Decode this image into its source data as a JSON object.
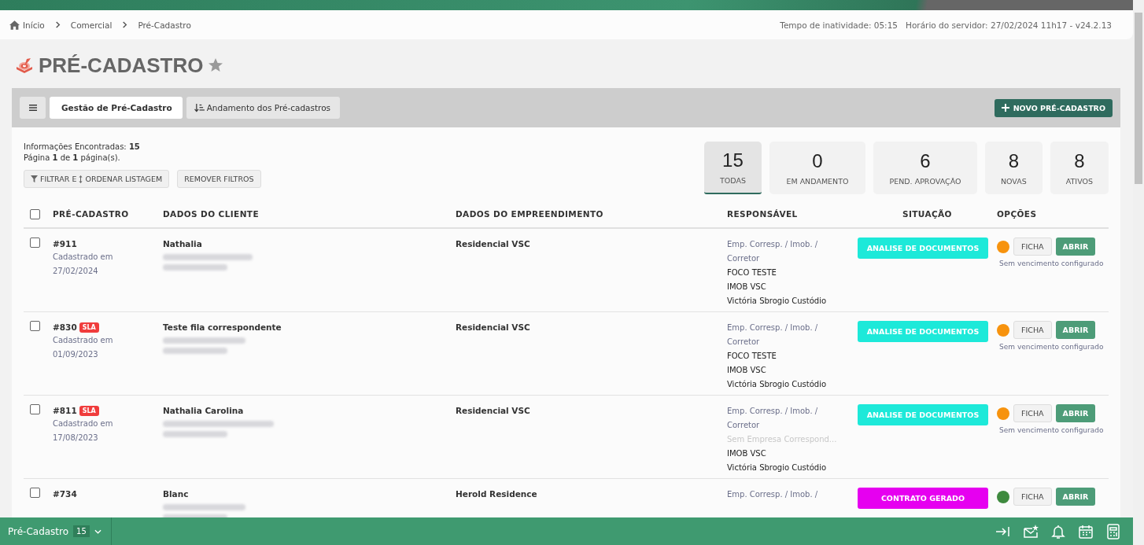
{
  "breadcrumb": [
    {
      "label": "Início",
      "kind": "home"
    },
    {
      "label": "Comercial"
    },
    {
      "label": "Pré-Cadastro"
    }
  ],
  "status_info": {
    "idle": "Tempo de inatividade: 05:15",
    "server": "Horário do servidor: 27/02/2024 11h17 - v24.2.13"
  },
  "page_title": "PRÉ-CADASTRO",
  "favorite": false,
  "tabs": [
    {
      "label": "Gestão de Pré-Cadastro",
      "selected": true,
      "kind": "plain"
    },
    {
      "label": "Andamento dos Pré-cadastros",
      "selected": false,
      "kind": "sort"
    }
  ],
  "new_button": "NOVO PRÉ-CADASTRO",
  "summary": {
    "found_label": "Informações Encontradas: ",
    "found": "15",
    "page_text": "Página **1** de **1** página(s)."
  },
  "filter_buttons": [
    {
      "label": "FILTRAR E",
      "label2": "ORDENAR LISTAGEM",
      "kind": "filter"
    },
    {
      "label": "REMOVER FILTROS",
      "kind": "plain"
    }
  ],
  "counters": [
    {
      "value": "15",
      "label": "TODAS",
      "selected": true
    },
    {
      "value": "0",
      "label": "EM ANDAMENTO",
      "selected": false
    },
    {
      "value": "6",
      "label": "PEND. APROVAÇÃO",
      "selected": false
    },
    {
      "value": "8",
      "label": "NOVAS",
      "selected": false
    },
    {
      "value": "8",
      "label": "ATIVOS",
      "selected": false
    }
  ],
  "table": {
    "all_checked": false,
    "columns": [
      "PRÉ-CADASTRO",
      "DADOS DO CLIENTE",
      "DADOS DO EMPREENDIMENTO",
      "RESPONSÁVEL",
      "SITUAÇÃO",
      "OPÇÕES"
    ],
    "rows": [
      {
        "checked": false,
        "id": "#911",
        "sla": null,
        "registered": "Cadastrado em",
        "date": "27/02/2024",
        "client": "Nathalia",
        "project": "Residencial VSC",
        "resp_label": "Emp. Corresp. / Imob. / Corretor",
        "resp": [
          {
            "text": "FOCO TESTE",
            "muted": false
          },
          {
            "text": "IMOB VSC",
            "muted": false
          },
          {
            "text": "Victória Sbrogio Custódio",
            "muted": false
          }
        ],
        "status": {
          "text": "ANALISE DE DOCUMENTOS",
          "color": "#1de9d9"
        },
        "indicator": {
          "color": "#f7930e"
        },
        "buttons": [
          "FICHA",
          "ABRIR"
        ],
        "due": "Sem vencimento configurado"
      },
      {
        "checked": false,
        "id": "#830",
        "sla": "SLA",
        "registered": "Cadastrado em",
        "date": "01/09/2023",
        "client": "Teste fila correspondente",
        "project": "Residencial VSC",
        "resp_label": "Emp. Corresp. / Imob. / Corretor",
        "resp": [
          {
            "text": "FOCO TESTE",
            "muted": false
          },
          {
            "text": "IMOB VSC",
            "muted": false
          },
          {
            "text": "Victória Sbrogio Custódio",
            "muted": false
          }
        ],
        "status": {
          "text": "ANALISE DE DOCUMENTOS",
          "color": "#1de9d9"
        },
        "indicator": {
          "color": "#f7930e"
        },
        "buttons": [
          "FICHA",
          "ABRIR"
        ],
        "due": "Sem vencimento configurado"
      },
      {
        "checked": false,
        "id": "#811",
        "sla": "SLA",
        "registered": "Cadastrado em",
        "date": "17/08/2023",
        "client": "Nathalia Carolina",
        "project": "Residencial VSC",
        "resp_label": "Emp. Corresp. / Imob. / Corretor",
        "resp": [
          {
            "text": "Sem Empresa Correspond...",
            "muted": true
          },
          {
            "text": "IMOB VSC",
            "muted": false
          },
          {
            "text": "Victória Sbrogio Custódio",
            "muted": false
          }
        ],
        "status": {
          "text": "ANALISE DE DOCUMENTOS",
          "color": "#1de9d9"
        },
        "indicator": {
          "color": "#f7930e"
        },
        "buttons": [
          "FICHA",
          "ABRIR"
        ],
        "due": "Sem vencimento configurado"
      },
      {
        "checked": false,
        "id": "#734",
        "sla": null,
        "client": "Blanc",
        "project": "Herold Residence",
        "resp_label": "Emp. Corresp. / Imob. /",
        "resp": [],
        "status": {
          "text": "CONTRATO GERADO",
          "color": "#e600f0"
        },
        "indicator": {
          "color": "#3f8a3f"
        },
        "buttons": [
          "FICHA",
          "ABRIR"
        ]
      }
    ]
  },
  "footer": {
    "label": "Pré-Cadastro",
    "count": "15"
  }
}
